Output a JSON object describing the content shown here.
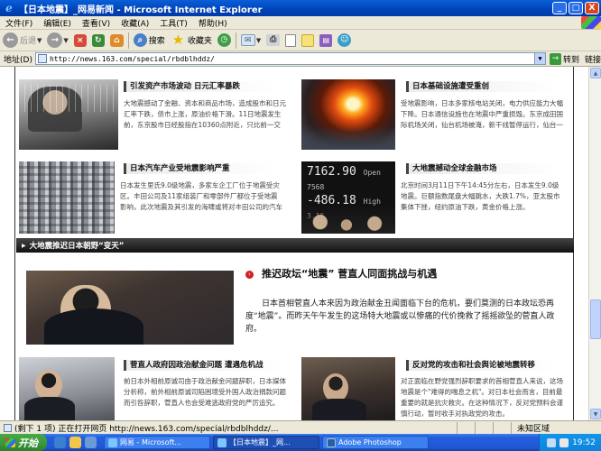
{
  "window": {
    "title": "【日本地震】_网易新闻 - Microsoft Internet Explorer",
    "minimize": "_",
    "maximize": "□",
    "close": "X"
  },
  "menu": [
    "文件(F)",
    "编辑(E)",
    "查看(V)",
    "收藏(A)",
    "工具(T)",
    "帮助(H)"
  ],
  "toolbar": {
    "back": "后退",
    "search": "搜索",
    "favorites": "收藏夹"
  },
  "address": {
    "label": "地址(D)",
    "url": "http://news.163.com/special/rbdblhddz/",
    "go": "转到",
    "links": "链接"
  },
  "articles": [
    {
      "title": "引发资产市场波动 日元汇率暴跌",
      "body": "大地震撼动了金融、资本和商品市场，造成股市和日元汇率下跌，债市上涨，原油价格下滑。11日地震发生前，东京股市日经股指在10360点附近，只比前一交易日下跌70点。"
    },
    {
      "title": "日本基础设施遭受重创",
      "body": "受地震影响，日本多家核电站关闭，电力供应能力大幅下降。日本通信设施也在地震中严重损毁。东京成田国际机场关闭，仙台机场被淹，新干线暂停运行，仙台一家化工厂发生大爆炸。"
    },
    {
      "title": "日本汽车产业受地震影响严重",
      "body": "日本发生里氏9.0级地震，多家车企工厂位于地震受灾区。丰田公司及11家组装厂和零部件厂都位于受地震影响，此次地震及其引发的海啸或将对丰田公司的汽车生产产生一定的影响。"
    },
    {
      "title": "大地震撼动全球金融市场",
      "body": "北京时间3月11日下午14:45分左右，日本发生9.0级地震。巨额指数尾盘大幅跳水，大跌1.7%，亚太股市集体下挫，纽约原油下跌，黄金价格上涨。"
    }
  ],
  "board": {
    "row1_left": "7162.90",
    "row1_right": "7568",
    "row2_left": "-486.18",
    "row2_right": "3.16",
    "row3_a": "Open",
    "row3_b": "High"
  },
  "section": {
    "title": "大地震推迟日本朝野“变天”"
  },
  "lead": {
    "title": "推迟政坛“地震” 菅直人同面挑战与机遇",
    "body": "日本首相菅直人本来因为政治献金丑闻面临下台的危机，要们莫测的日本政坛恐再度“地震”。而昨天午午发生的这场特大地震或以惨痛的代价挽救了摇摇欲坠的菅直人政府。"
  },
  "bottom_articles": [
    {
      "title": "菅直人政府因政治献金问题 遭遇危机战",
      "body": "前日本外相前原诚司由于政治献金问题辞职，日本媒体分析称，前外相前原诚司陷困境受外国人政治捐款问题而引咎辞职，菅直人也会受难逃政府党的严厉追究。"
    },
    {
      "title": "反对党的攻击和社会舆论被地震转移",
      "body": "对正面临在野党强烈辞职要求的首相菅直人来说，这场地震是个\"难得的喘息之机\"。对日本社会而言，目前最重要的就是抗灾救灾。在这种情况下，反对党预料会谨慎行动，暂时收手对执政党的攻击。"
    }
  ],
  "status": {
    "text": "(剩下 1 项) 正在打开网页 http://news.163.com/special/rbdblhddz/...",
    "zone": "未知区域"
  },
  "taskbar": {
    "start": "开始",
    "tasks": [
      "网易 - Microsoft...",
      "【日本地震】_网...",
      "Adobe Photoshop"
    ],
    "clock": "19:52"
  },
  "colors": {
    "title_bar": "#0043b8",
    "chrome": "#ece9d8",
    "taskbar": "#245edb",
    "start": "#3a963a",
    "accent_red": "#d12020"
  }
}
